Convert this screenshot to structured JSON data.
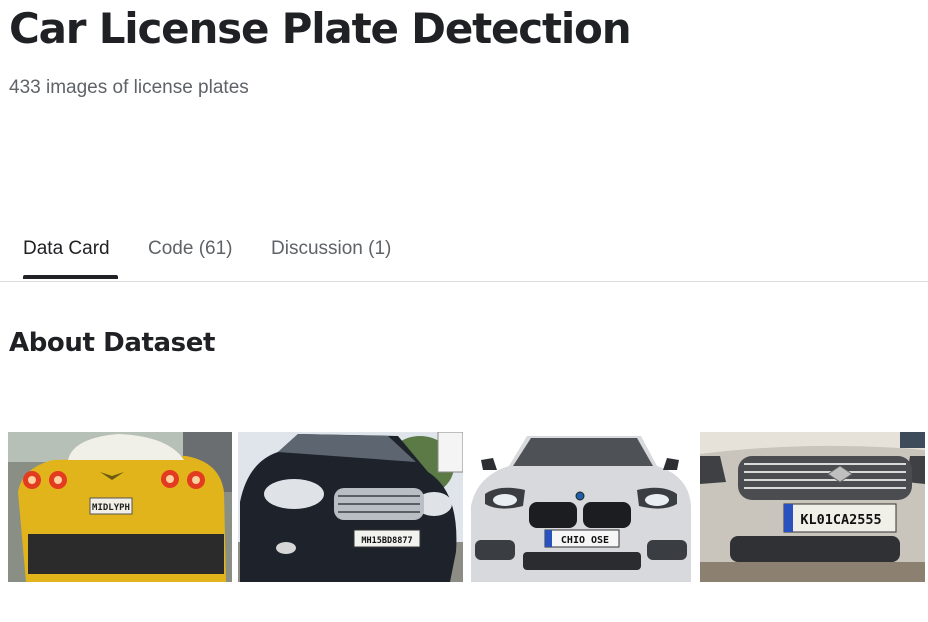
{
  "header": {
    "title": "Car License Plate Detection",
    "subtitle": "433 images of license plates"
  },
  "tabs": [
    {
      "label": "Data Card",
      "active": true
    },
    {
      "label": "Code (61)",
      "active": false
    },
    {
      "label": "Discussion (1)",
      "active": false
    }
  ],
  "section": {
    "title": "About Dataset"
  },
  "images": [
    {
      "plate": "MIDLYPH",
      "car_color": "#e1b41c"
    },
    {
      "plate": "MH15BD8877",
      "car_color": "#1e232b"
    },
    {
      "plate": "CHIO OSE",
      "car_color": "#d7d9dc"
    },
    {
      "plate": "KL01CA2555",
      "car_color": "#c9c4bc"
    }
  ],
  "colors": {
    "active_tab_underline": "#202124",
    "divider": "#dadce0"
  }
}
